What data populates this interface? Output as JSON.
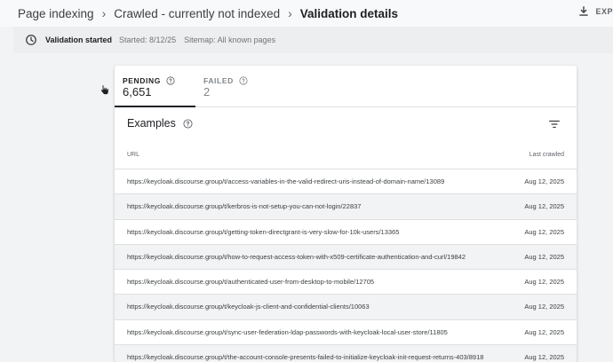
{
  "breadcrumb": {
    "items": [
      "Page indexing",
      "Crawled - currently not indexed",
      "Validation details"
    ]
  },
  "toolbar": {
    "export_label": "EXP"
  },
  "validation": {
    "title": "Validation started",
    "started": "Started: 8/12/25",
    "sitemap": "Sitemap: All known pages"
  },
  "tabs": {
    "pending": {
      "label": "PENDING",
      "count": "6,651"
    },
    "failed": {
      "label": "FAILED",
      "count": "2"
    }
  },
  "examples": {
    "title": "Examples",
    "columns": {
      "url": "URL",
      "last_crawled": "Last crawled"
    },
    "rows": [
      {
        "url": "https://keycloak.discourse.group/t/access-variables-in-the-valid-redirect-uris-instead-of-domain-name/13089",
        "date": "Aug 12, 2025"
      },
      {
        "url": "https://keycloak.discourse.group/t/kerbros-is-not-setup-you-can-not-login/22837",
        "date": "Aug 12, 2025"
      },
      {
        "url": "https://keycloak.discourse.group/t/getting-token-directgrant-is-very-slow-for-10k-users/13365",
        "date": "Aug 12, 2025"
      },
      {
        "url": "https://keycloak.discourse.group/t/how-to-request-access-token-with-x509-certificate-authentication-and-curl/19842",
        "date": "Aug 12, 2025"
      },
      {
        "url": "https://keycloak.discourse.group/t/authenticated-user-from-desktop-to-mobile/12705",
        "date": "Aug 12, 2025"
      },
      {
        "url": "https://keycloak.discourse.group/t/keycloak-js-client-and-confidential-clients/10063",
        "date": "Aug 12, 2025"
      },
      {
        "url": "https://keycloak.discourse.group/t/sync-user-federation-ldap-passwords-with-keycloak-local-user-store/11805",
        "date": "Aug 12, 2025"
      },
      {
        "url": "https://keycloak.discourse.group/t/the-account-console-presents-failed-to-initialize-keycloak-init-request-returns-403/8918",
        "date": "Aug 12, 2025"
      }
    ]
  },
  "icons": {
    "clock": "clock-icon",
    "help": "help-circle-icon",
    "filter": "filter-icon",
    "download": "download-icon",
    "cursor": "hand-pointer-icon"
  }
}
